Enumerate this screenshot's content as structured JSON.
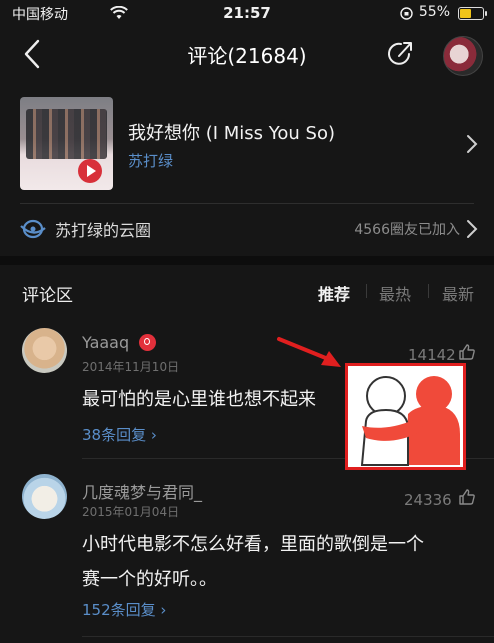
{
  "status_bar": {
    "carrier": "中国移动",
    "time": "21:57",
    "battery": "55%",
    "battery_level": 0.55
  },
  "nav": {
    "title": "评论(21684)"
  },
  "song": {
    "title": "我好想你 (I Miss You So)",
    "artist": "苏打绿"
  },
  "circle": {
    "label": "苏打绿的云圈",
    "members": "4566圈友已加入"
  },
  "comments_header": {
    "label": "评论区",
    "sort_options": [
      "推荐",
      "最热",
      "最新"
    ]
  },
  "comments": [
    {
      "user": "Yaaaq",
      "date": "2014年11月10日",
      "likes": "14142",
      "text": "最可怕的是心里谁也想不起来",
      "replies": "38条回复"
    },
    {
      "user": "几度魂梦与君同_",
      "date": "2015年01月04日",
      "likes": "24336",
      "text_lines": [
        "小时代电影不怎么好看，里面的歌倒是一个",
        "赛一个的好听。。"
      ],
      "replies": "152条回复"
    }
  ],
  "colors": {
    "background": "#161616",
    "link": "#5a8ec9",
    "accent_red": "#e01f1f"
  }
}
